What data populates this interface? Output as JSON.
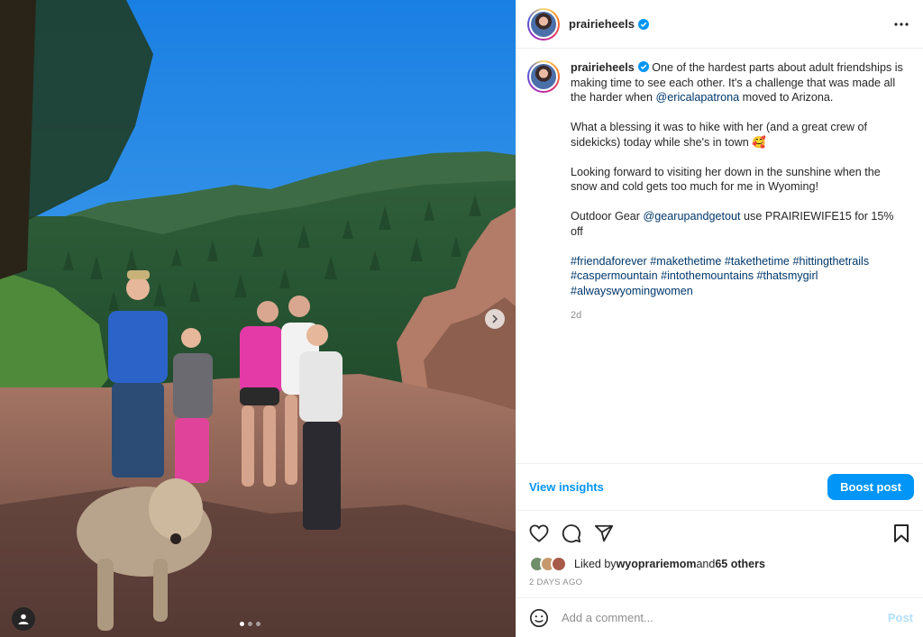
{
  "post": {
    "author": "prairieheels",
    "verified": true,
    "caption_author": "prairieheels",
    "caption_paragraphs": [
      [
        {
          "t": "text",
          "v": " One of the hardest parts about adult friendships is making time to see each other. It's a challenge that was made all the harder when "
        },
        {
          "t": "mention",
          "v": "@ericalapatrona"
        },
        {
          "t": "text",
          "v": " moved to Arizona."
        }
      ],
      [
        {
          "t": "text",
          "v": "What a blessing it was to hike with her (and a great crew of sidekicks) today while she's in town 🥰"
        }
      ],
      [
        {
          "t": "text",
          "v": "Looking forward to visiting her down in the sunshine when the snow and cold gets too much for me in Wyoming!"
        }
      ],
      [
        {
          "t": "text",
          "v": "Outdoor Gear "
        },
        {
          "t": "mention",
          "v": "@gearupandgetout"
        },
        {
          "t": "text",
          "v": " use PRAIRIEWIFE15 for 15% off"
        }
      ],
      [
        {
          "t": "tag",
          "v": "#friendaforever"
        },
        {
          "t": "text",
          "v": " "
        },
        {
          "t": "tag",
          "v": "#makethetime"
        },
        {
          "t": "text",
          "v": " "
        },
        {
          "t": "tag",
          "v": "#takethetime"
        },
        {
          "t": "text",
          "v": " "
        },
        {
          "t": "tag",
          "v": "#hittingthetrails"
        },
        {
          "t": "text",
          "v": " "
        },
        {
          "t": "tag",
          "v": "#caspermountain"
        },
        {
          "t": "text",
          "v": " "
        },
        {
          "t": "tag",
          "v": "#intothemountains"
        },
        {
          "t": "text",
          "v": " "
        },
        {
          "t": "tag",
          "v": "#thatsmygirl"
        },
        {
          "t": "text",
          "v": " "
        },
        {
          "t": "tag",
          "v": "#alwayswyomingwomen"
        }
      ]
    ],
    "time_ago": "2d",
    "view_insights": "View insights",
    "boost_label": "Boost post",
    "liked_by_prefix": "Liked by ",
    "liked_by_user": "wyoprariemom",
    "liked_by_and": " and ",
    "liked_by_others": "65 others",
    "date_label": "2 DAYS AGO",
    "comment_placeholder": "Add a comment...",
    "post_label": "Post"
  },
  "carousel": {
    "slide_count": 3,
    "active_index": 0
  },
  "icons": {
    "more": "more-options-icon",
    "like": "heart-icon",
    "comment": "comment-icon",
    "share": "share-icon",
    "save": "bookmark-icon",
    "emoji": "emoji-icon",
    "tagged": "tagged-user-icon",
    "next": "chevron-right-icon",
    "verified": "verified-badge-icon"
  },
  "colors": {
    "accent": "#0095f6",
    "link": "#00376b",
    "muted": "#8e8e8e"
  }
}
